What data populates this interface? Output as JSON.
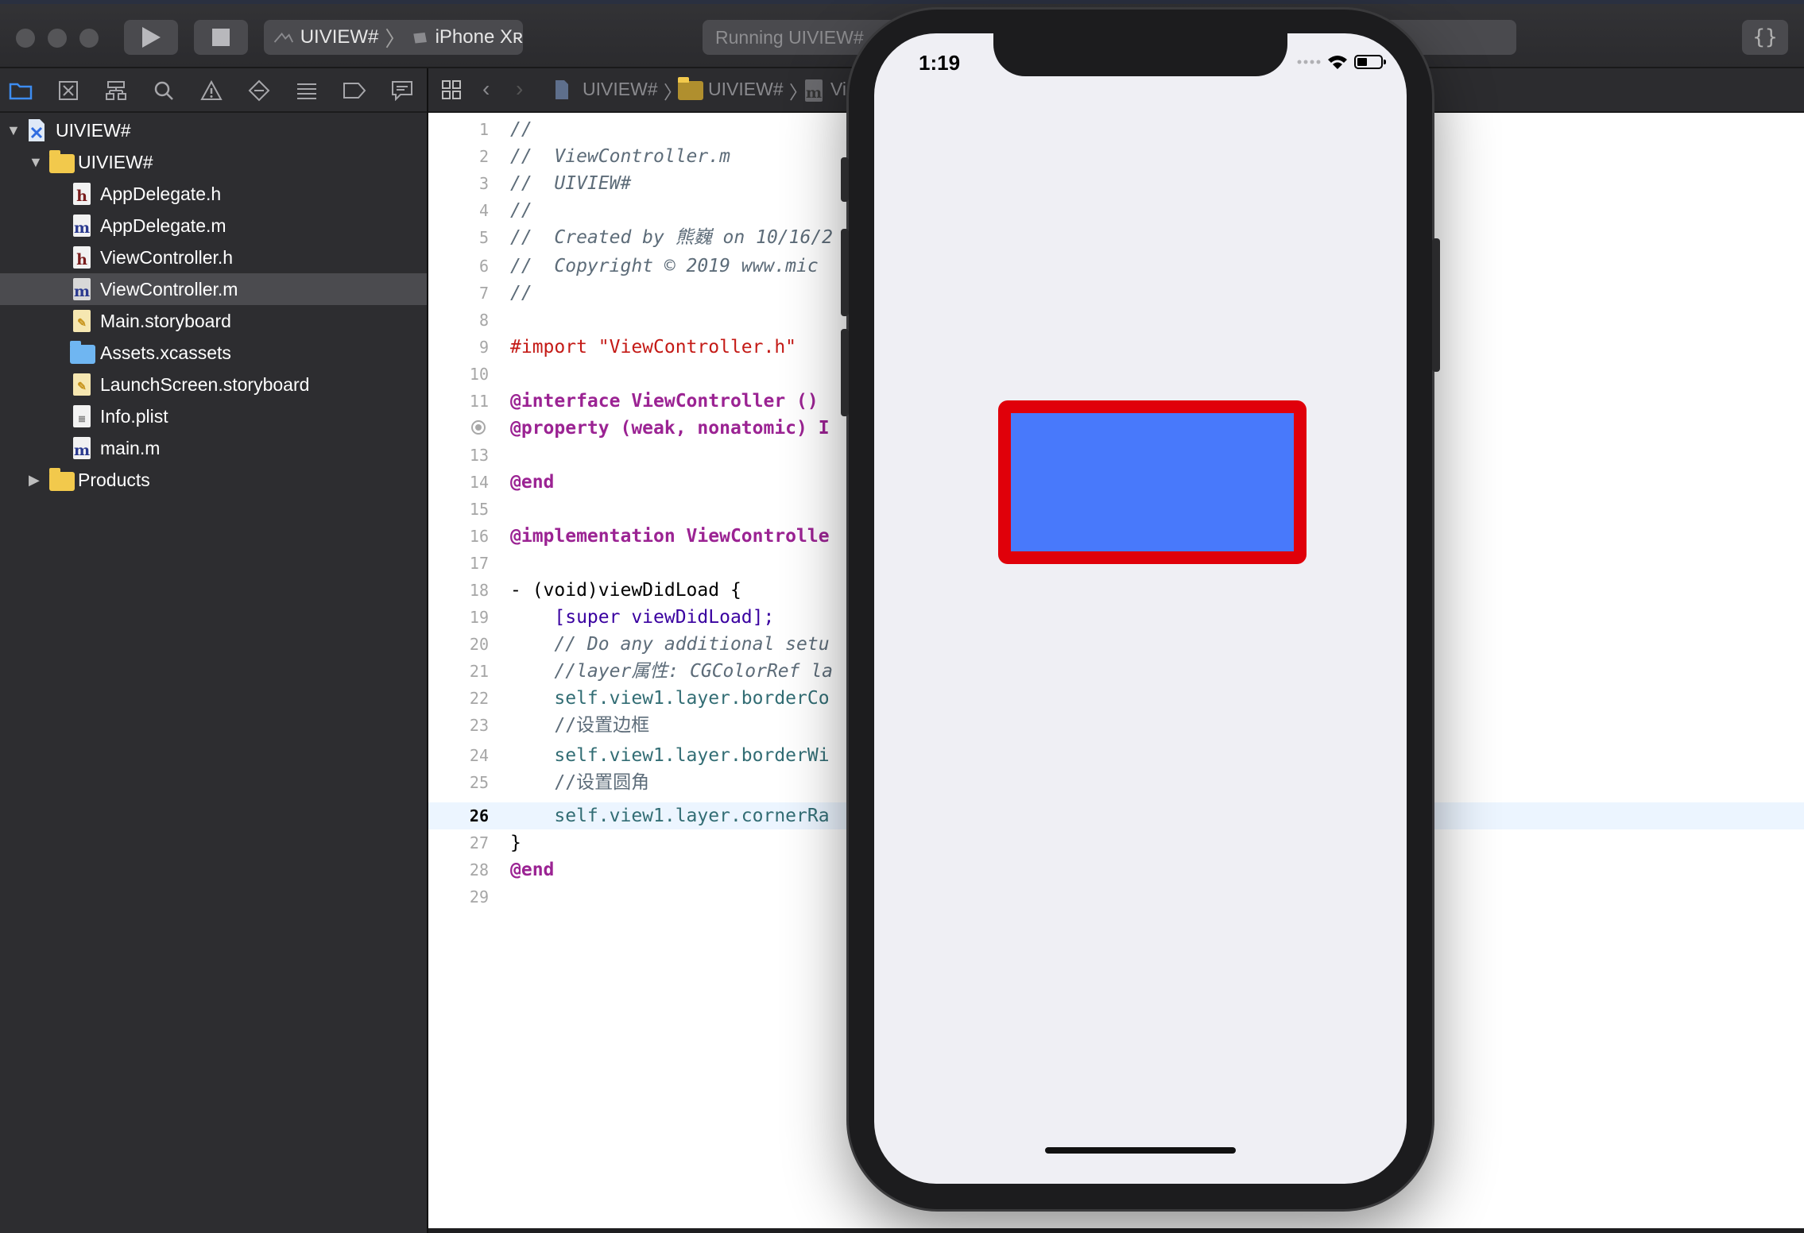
{
  "toolbar": {
    "scheme_project": "UIVIEW#",
    "scheme_device": "iPhone Xʀ",
    "status_text": "Running UIVIEW#",
    "braces_label": "{}"
  },
  "navigator": {
    "items": [
      {
        "label": "UIVIEW#"
      },
      {
        "label": "UIVIEW#"
      },
      {
        "label": "AppDelegate.h"
      },
      {
        "label": "AppDelegate.m"
      },
      {
        "label": "ViewController.h"
      },
      {
        "label": "ViewController.m"
      },
      {
        "label": "Main.storyboard"
      },
      {
        "label": "Assets.xcassets"
      },
      {
        "label": "LaunchScreen.storyboard"
      },
      {
        "label": "Info.plist"
      },
      {
        "label": "main.m"
      },
      {
        "label": "Products"
      }
    ],
    "selected_item": "ViewController.m"
  },
  "jumpbar": {
    "crumbs": [
      "UIVIEW#",
      "UIVIEW#",
      "Vi"
    ]
  },
  "editor": {
    "current_line": 26,
    "lines": [
      {
        "n": "1",
        "text": "//"
      },
      {
        "n": "2",
        "text": "//  ViewController.m"
      },
      {
        "n": "3",
        "text": "//  UIVIEW#"
      },
      {
        "n": "4",
        "text": "//"
      },
      {
        "n": "5",
        "text": "//  Created by 熊巍 on 10/16/2"
      },
      {
        "n": "6",
        "text": "//  Copyright © 2019 www.mic"
      },
      {
        "n": "7",
        "text": "//"
      },
      {
        "n": "8",
        "text": ""
      },
      {
        "n": "9",
        "text": "#import \"ViewController.h\""
      },
      {
        "n": "10",
        "text": ""
      },
      {
        "n": "11",
        "text": "@interface ViewController ()"
      },
      {
        "n": "12",
        "text": "@property (weak, nonatomic) I"
      },
      {
        "n": "13",
        "text": ""
      },
      {
        "n": "14",
        "text": "@end"
      },
      {
        "n": "15",
        "text": ""
      },
      {
        "n": "16",
        "text": "@implementation ViewControlle"
      },
      {
        "n": "17",
        "text": ""
      },
      {
        "n": "18",
        "text": "- (void)viewDidLoad {"
      },
      {
        "n": "19",
        "text": "    [super viewDidLoad];"
      },
      {
        "n": "20",
        "text": "    // Do any additional setu"
      },
      {
        "n": "21",
        "text": "    //layer属性: CGColorRef la"
      },
      {
        "n": "22",
        "text": "    self.view1.layer.borderCo"
      },
      {
        "n": "23",
        "text": "    //设置边框"
      },
      {
        "n": "24",
        "text": "    self.view1.layer.borderWi"
      },
      {
        "n": "25",
        "text": "    //设置圆角"
      },
      {
        "n": "26",
        "text": "    self.view1.layer.cornerRa"
      },
      {
        "n": "27",
        "text": "}"
      },
      {
        "n": "28",
        "text": "@end"
      },
      {
        "n": "29",
        "text": ""
      }
    ]
  },
  "simulator": {
    "time": "1:19",
    "view1_fill": "#4879fb",
    "view1_border": "#e0000a",
    "screen_bg": "#efeff4"
  }
}
